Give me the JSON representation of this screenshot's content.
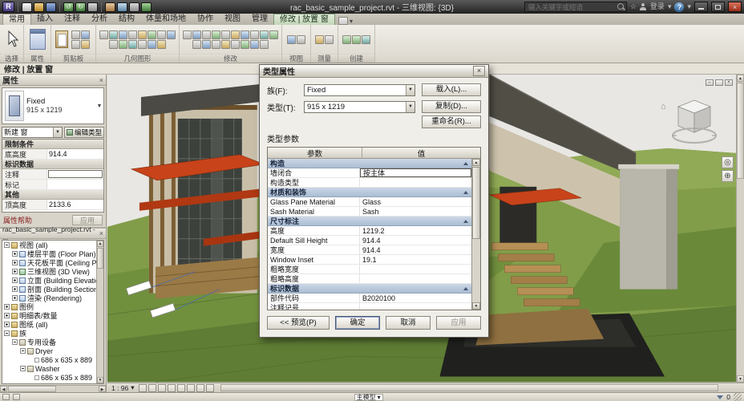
{
  "icons": {
    "logo": "R",
    "close": "×",
    "min": "–",
    "caret_down": "▾",
    "arrow_down": "▼",
    "arrow_up": "▲",
    "arrow_left": "◀",
    "arrow_right": "▶",
    "star": "☆",
    "help": "?",
    "home": "⌂",
    "wheel": "◎",
    "zoom": "⊕",
    "undo": "↺",
    "redo": "↻"
  },
  "titlebar": {
    "title": "rac_basic_sample_project.rvt - 三维视图: {3D}",
    "search_placeholder": "键入关键字或短语",
    "signin": "登录"
  },
  "ribbon": {
    "tabs": [
      "常用",
      "插入",
      "注释",
      "分析",
      "结构",
      "体量和场地",
      "协作",
      "视图",
      "管理",
      "修改 | 放置 窗"
    ],
    "panels": [
      "选择",
      "属性",
      "剪贴板",
      "几何图形",
      "修改",
      "视图",
      "测量",
      "创建"
    ]
  },
  "options_bar": {
    "label": "修改 | 放置 窗"
  },
  "properties": {
    "title": "属性",
    "type_name": "Fixed",
    "type_size": "915 x 1219",
    "selector": "新建 窗",
    "edit_type": "编辑类型",
    "sec1": "限制条件",
    "r1l": "底高度",
    "r1v": "914.4",
    "sec2": "标识数据",
    "r2l": "注释",
    "r2v": "",
    "r3l": "标记",
    "r3v": "",
    "sec3": "其他",
    "r4l": "顶高度",
    "r4v": "2133.6",
    "help": "属性帮助",
    "apply": "应用"
  },
  "browser": {
    "title": "rac_basic_sample_project.rvt - ...",
    "items": [
      "视图 (all)",
      "楼层平面 (Floor Plan)",
      "天花板平面 (Ceiling Plan)",
      "三维视图 (3D View)",
      "立面 (Building Elevation)",
      "剖面 (Building Section)",
      "渲染 (Rendering)",
      "图例",
      "明细表/数量",
      "图纸 (all)",
      "族",
      "专用设备",
      "Dryer",
      "686 x 635 x 889",
      "Washer",
      "686 x 635 x 889"
    ]
  },
  "dialog": {
    "title": "类型属性",
    "family_label": "族(F):",
    "family_value": "Fixed",
    "type_label": "类型(T):",
    "type_value": "915 x 1219",
    "load": "载入(L)...",
    "duplicate": "复制(D)...",
    "rename": "重命名(R)...",
    "params_label": "类型参数",
    "col_param": "参数",
    "col_value": "值",
    "rows": [
      {
        "t": "g",
        "l": "构造",
        "v": ""
      },
      {
        "t": "p",
        "l": "墙闭合",
        "v": "按主体"
      },
      {
        "t": "p",
        "l": "构造类型",
        "v": ""
      },
      {
        "t": "g",
        "l": "材质和装饰",
        "v": ""
      },
      {
        "t": "p",
        "l": "Glass Pane Material",
        "v": "Glass"
      },
      {
        "t": "p",
        "l": "Sash Material",
        "v": "Sash"
      },
      {
        "t": "g",
        "l": "尺寸标注",
        "v": ""
      },
      {
        "t": "p",
        "l": "高度",
        "v": "1219.2"
      },
      {
        "t": "p",
        "l": "Default Sill Height",
        "v": "914.4"
      },
      {
        "t": "p",
        "l": "宽度",
        "v": "914.4"
      },
      {
        "t": "p",
        "l": "Window Inset",
        "v": "19.1"
      },
      {
        "t": "p",
        "l": "粗略宽度",
        "v": ""
      },
      {
        "t": "p",
        "l": "粗略高度",
        "v": ""
      },
      {
        "t": "g",
        "l": "标识数据",
        "v": ""
      },
      {
        "t": "p",
        "l": "部件代码",
        "v": "B2020100"
      },
      {
        "t": "p",
        "l": "注释记号",
        "v": ""
      }
    ],
    "preview": "<< 预览(P)",
    "ok": "确定",
    "cancel": "取消",
    "apply": "应用"
  },
  "view_controls": {
    "scale": "1 : 96"
  },
  "statusbar": {
    "model": "主模型",
    "filter_count": "0"
  }
}
